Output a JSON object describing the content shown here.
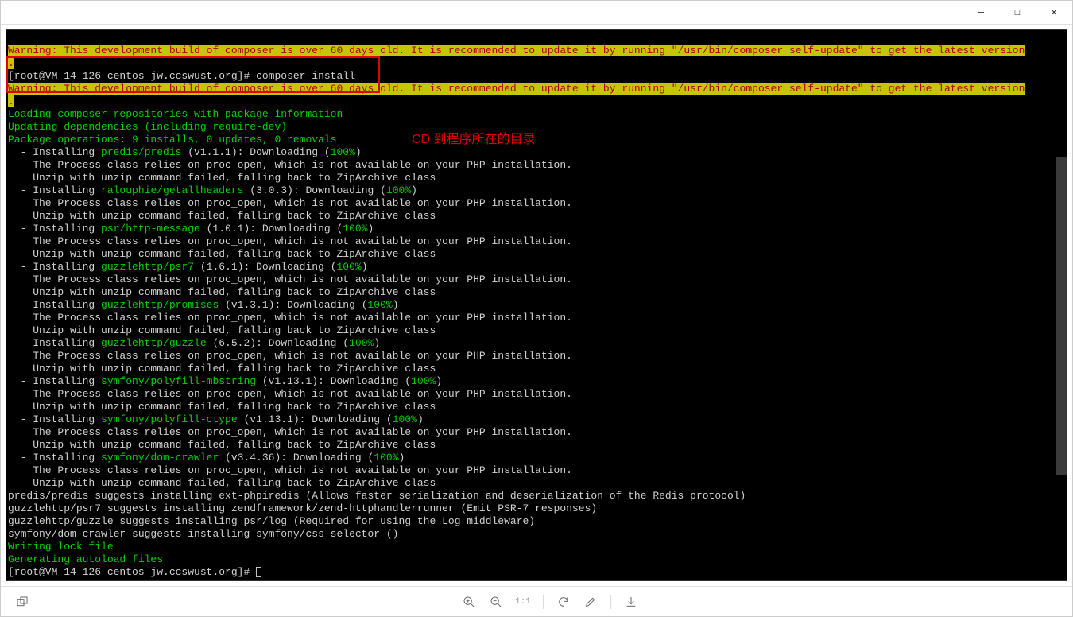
{
  "titlebar": {
    "minimize": "—",
    "maximize": "☐",
    "close": "✕"
  },
  "terminal": {
    "warning": "Warning: This development build of composer is over 60 days old. It is recommended to update it by running \"/usr/bin/composer self-update\" to get the latest version",
    "warning_dot": ".",
    "prompt1": "[root@VM_14_126_centos jw.ccswust.org]# ",
    "cmd1": "composer install",
    "loading": "Loading composer repositories with package information",
    "updating": "Updating dependencies (including require-dev)",
    "operations": "Package operations: 9 installs, 0 updates, 0 removals",
    "annotation": "CD 到程序所在的目录",
    "installs": [
      {
        "indent": "  - Installing ",
        "pkg": "predis/predis",
        "ver": " (v1.1.1): Downloading (",
        "pct": "100%",
        "end": ")"
      },
      {
        "indent": "  - Installing ",
        "pkg": "ralouphie/getallheaders",
        "ver": " (3.0.3): Downloading (",
        "pct": "100%",
        "end": ")"
      },
      {
        "indent": "  - Installing ",
        "pkg": "psr/http-message",
        "ver": " (1.0.1): Downloading (",
        "pct": "100%",
        "end": ")"
      },
      {
        "indent": "  - Installing ",
        "pkg": "guzzlehttp/psr7",
        "ver": " (1.6.1): Downloading (",
        "pct": "100%",
        "end": ")"
      },
      {
        "indent": "  - Installing ",
        "pkg": "guzzlehttp/promises",
        "ver": " (v1.3.1): Downloading (",
        "pct": "100%",
        "end": ")"
      },
      {
        "indent": "  - Installing ",
        "pkg": "guzzlehttp/guzzle",
        "ver": " (6.5.2): Downloading (",
        "pct": "100%",
        "end": ")"
      },
      {
        "indent": "  - Installing ",
        "pkg": "symfony/polyfill-mbstring",
        "ver": " (v1.13.1): Downloading (",
        "pct": "100%",
        "end": ")"
      },
      {
        "indent": "  - Installing ",
        "pkg": "symfony/polyfill-ctype",
        "ver": " (v1.13.1): Downloading (",
        "pct": "100%",
        "end": ")"
      },
      {
        "indent": "  - Installing ",
        "pkg": "symfony/dom-crawler",
        "ver": " (v3.4.36): Downloading (",
        "pct": "100%",
        "end": ")"
      }
    ],
    "proc_line": "    The Process class relies on proc_open, which is not available on your PHP installation.",
    "unzip_line": "    Unzip with unzip command failed, falling back to ZipArchive class",
    "suggest1": "predis/predis suggests installing ext-phpiredis (Allows faster serialization and deserialization of the Redis protocol)",
    "suggest2": "guzzlehttp/psr7 suggests installing zendframework/zend-httphandlerrunner (Emit PSR-7 responses)",
    "suggest3": "guzzlehttp/guzzle suggests installing psr/log (Required for using the Log middleware)",
    "suggest4": "symfony/dom-crawler suggests installing symfony/css-selector ()",
    "writing": "Writing lock file",
    "generating": "Generating autoload files",
    "prompt2": "[root@VM_14_126_centos jw.ccswust.org]# "
  },
  "toolbar": {
    "double_window": "double-window-icon",
    "zoom_in": "zoom-in-icon",
    "zoom_out": "zoom-out-icon",
    "one_to_one": "1:1",
    "refresh": "refresh-icon",
    "edit": "edit-icon",
    "download": "download-icon"
  }
}
